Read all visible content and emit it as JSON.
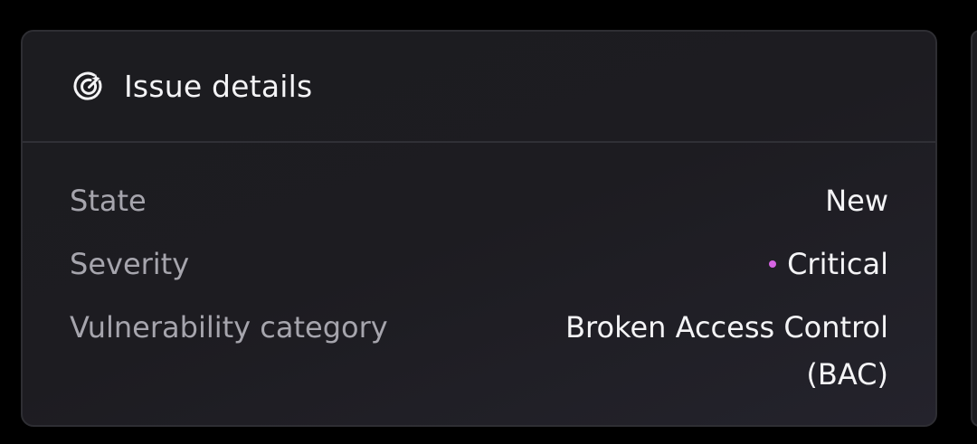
{
  "card": {
    "title": "Issue details",
    "icon": "radar-target-icon"
  },
  "details": {
    "state": {
      "label": "State",
      "value": "New"
    },
    "severity": {
      "label": "Severity",
      "value": "Critical",
      "color": "#d664e3"
    },
    "vulnerability_category": {
      "label": "Vulnerability category",
      "value": "Broken Access Control (BAC)"
    }
  },
  "colors": {
    "background": "#000000",
    "card_bg": "#1c1c20",
    "border": "#2e2e33",
    "label": "#a6a5ad",
    "value": "#f4f4f6",
    "critical": "#d664e3"
  }
}
